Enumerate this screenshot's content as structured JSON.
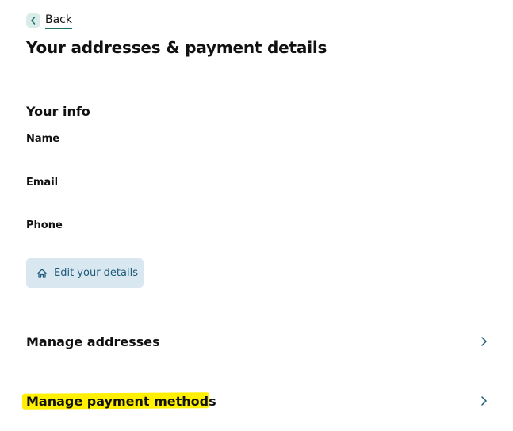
{
  "back": {
    "label": "Back"
  },
  "page": {
    "title": "Your addresses & payment details"
  },
  "your_info": {
    "title": "Your info",
    "name_label": "Name",
    "email_label": "Email",
    "phone_label": "Phone",
    "edit_button_label": "Edit your details"
  },
  "manage_addresses": {
    "label": "Manage addresses"
  },
  "manage_payment": {
    "label": "Manage payment methods",
    "highlight_color": "#ffef00"
  },
  "colors": {
    "accent_teal": "#1f6f64",
    "button_bg": "#d9e7f0",
    "button_text": "#1e5a7a",
    "chevron": "#1e5a7a"
  },
  "icons": {
    "back": "chevron-left-icon",
    "edit": "home-icon",
    "row_arrow": "chevron-right-icon"
  }
}
